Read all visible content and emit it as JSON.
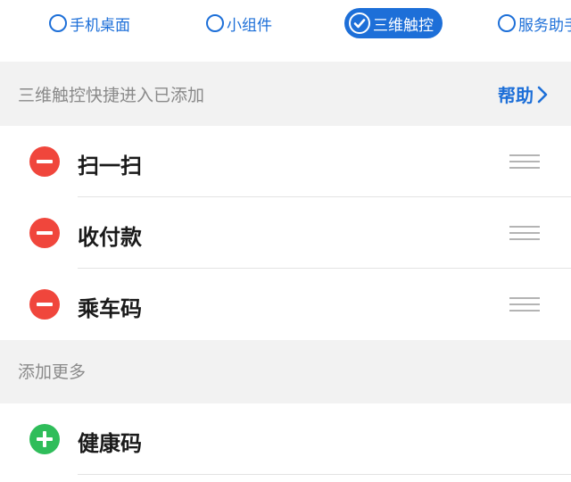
{
  "tabs": [
    {
      "label": "手机桌面",
      "selected": false
    },
    {
      "label": "小组件",
      "selected": false
    },
    {
      "label": "三维触控",
      "selected": true
    },
    {
      "label": "服务助手",
      "selected": false
    }
  ],
  "added_section": {
    "title": "三维触控快捷进入已添加",
    "help_label": "帮助"
  },
  "added_items": [
    {
      "label": "扫一扫"
    },
    {
      "label": "收付款"
    },
    {
      "label": "乘车码"
    }
  ],
  "more_section": {
    "title": "添加更多"
  },
  "more_items": [
    {
      "label": "健康码"
    }
  ],
  "colors": {
    "accent": "#1d6fd8",
    "remove": "#f0463c",
    "add": "#2fbd5a",
    "section_bg": "#f2f2f2"
  }
}
